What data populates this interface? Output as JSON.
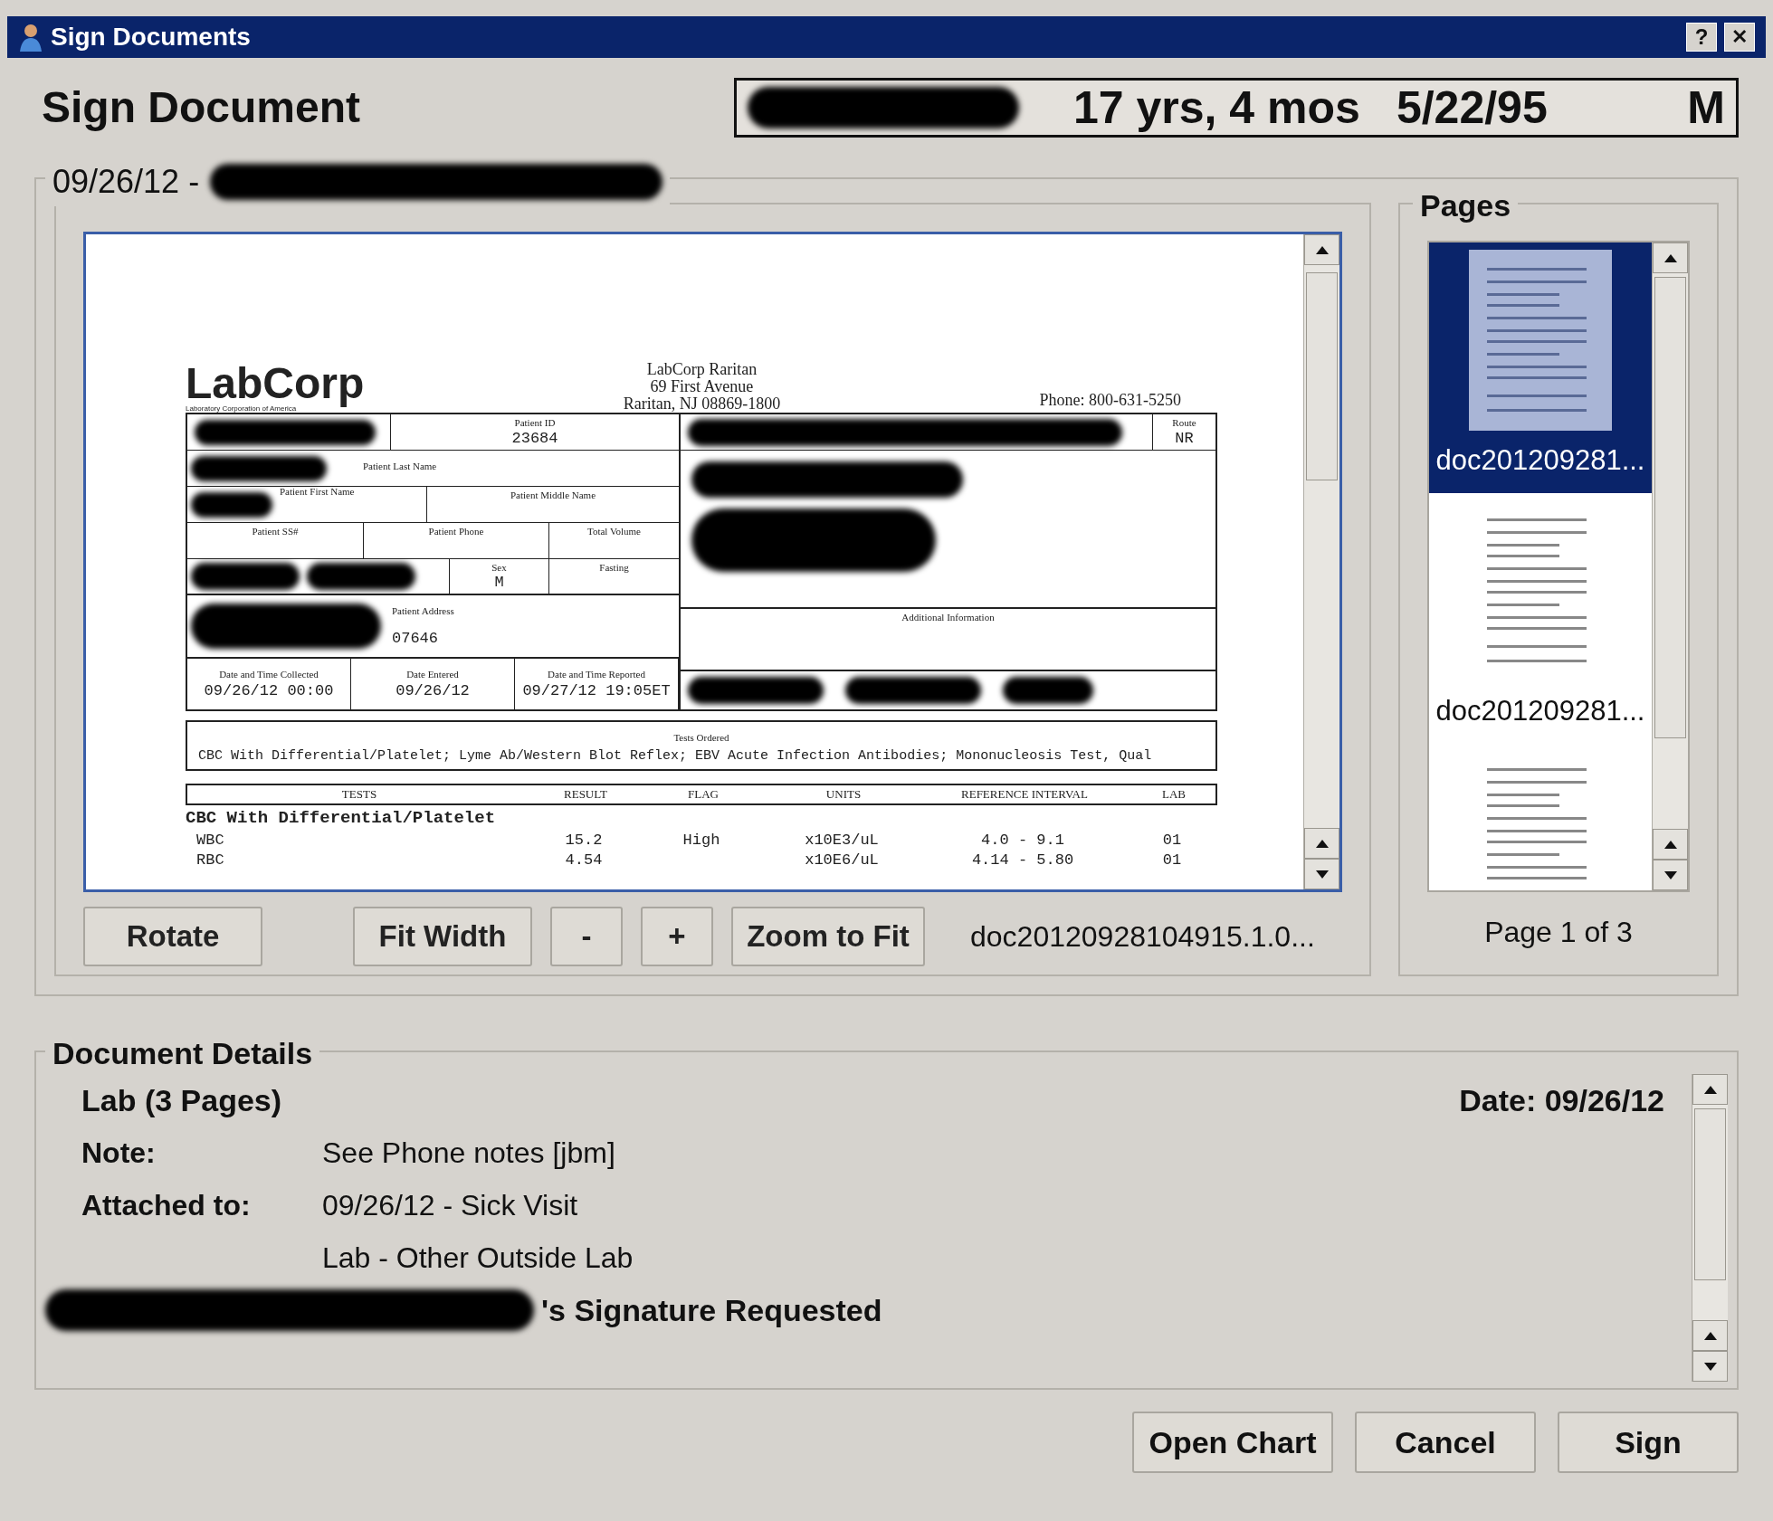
{
  "window": {
    "title": "Sign Documents",
    "help": "?",
    "close": "✕"
  },
  "heading": "Sign Document",
  "patient": {
    "age": "17 yrs, 4 mos",
    "dob": "5/22/95",
    "sex": "M"
  },
  "encounter": {
    "date": "09/26/12 -"
  },
  "scan": {
    "lab_name": "LabCorp",
    "lab_subtitle": "Laboratory Corporation of America",
    "address_lines": [
      "LabCorp Raritan",
      "69 First Avenue",
      "Raritan, NJ 08869-1800"
    ],
    "phone": "Phone: 800-631-5250",
    "patient_id": {
      "label": "Patient ID",
      "value": "23684"
    },
    "last_name": {
      "label": "Patient Last Name"
    },
    "first_name": {
      "label": "Patient First Name"
    },
    "middle_name": {
      "label": "Patient Middle Name"
    },
    "ssn": {
      "label": "Patient SS#"
    },
    "phone_field": {
      "label": "Patient Phone"
    },
    "volume": {
      "label": "Total Volume"
    },
    "sex": {
      "label": "Sex",
      "value": "M"
    },
    "fasting": {
      "label": "Fasting"
    },
    "address": {
      "label": "Patient Address",
      "value": "07646"
    },
    "route": {
      "label": "Route",
      "value": "NR"
    },
    "additional": {
      "label": "Additional Information"
    },
    "dates": [
      {
        "label": "Date and Time Collected",
        "value": "09/26/12 00:00"
      },
      {
        "label": "Date Entered",
        "value": "09/26/12"
      },
      {
        "label": "Date and Time Reported",
        "value": "09/27/12 19:05ET"
      }
    ],
    "tests_ordered": {
      "label": "Tests Ordered",
      "value": "CBC With Differential/Platelet; Lyme Ab/Western Blot Reflex; EBV Acute Infection Antibodies; Mononucleosis Test, Qual"
    },
    "columns": [
      "TESTS",
      "RESULT",
      "FLAG",
      "UNITS",
      "REFERENCE INTERVAL",
      "LAB"
    ],
    "group": "CBC With Differential/Platelet",
    "rows": [
      [
        "WBC",
        "15.2",
        "High",
        "x10E3/uL",
        "4.0 - 9.1",
        "01"
      ],
      [
        "RBC",
        "4.54",
        "",
        "x10E6/uL",
        "4.14 - 5.80",
        "01"
      ]
    ]
  },
  "viewer_buttons": [
    "Rotate",
    "Fit Width",
    "-",
    "+",
    "Zoom to Fit"
  ],
  "file_name": "doc20120928104915.1.0...",
  "pages": {
    "title": "Pages",
    "items": [
      {
        "label": "doc201209281...",
        "selected": true
      },
      {
        "label": "doc201209281...",
        "selected": false
      },
      {
        "selected": false
      }
    ],
    "footer": "Page 1 of 3"
  },
  "details": {
    "title": "Document Details",
    "doc_type": "Lab (3 Pages)",
    "date": "Date: 09/26/12",
    "rows": [
      {
        "label": "Note:",
        "value": "See Phone notes [jbm]"
      },
      {
        "label": "Attached to:",
        "value": "09/26/12 - Sick Visit"
      },
      {
        "value": "Lab - Other Outside Lab"
      }
    ],
    "signature": "'s Signature Requested"
  },
  "actions": [
    "Open Chart",
    "Cancel",
    "Sign"
  ]
}
